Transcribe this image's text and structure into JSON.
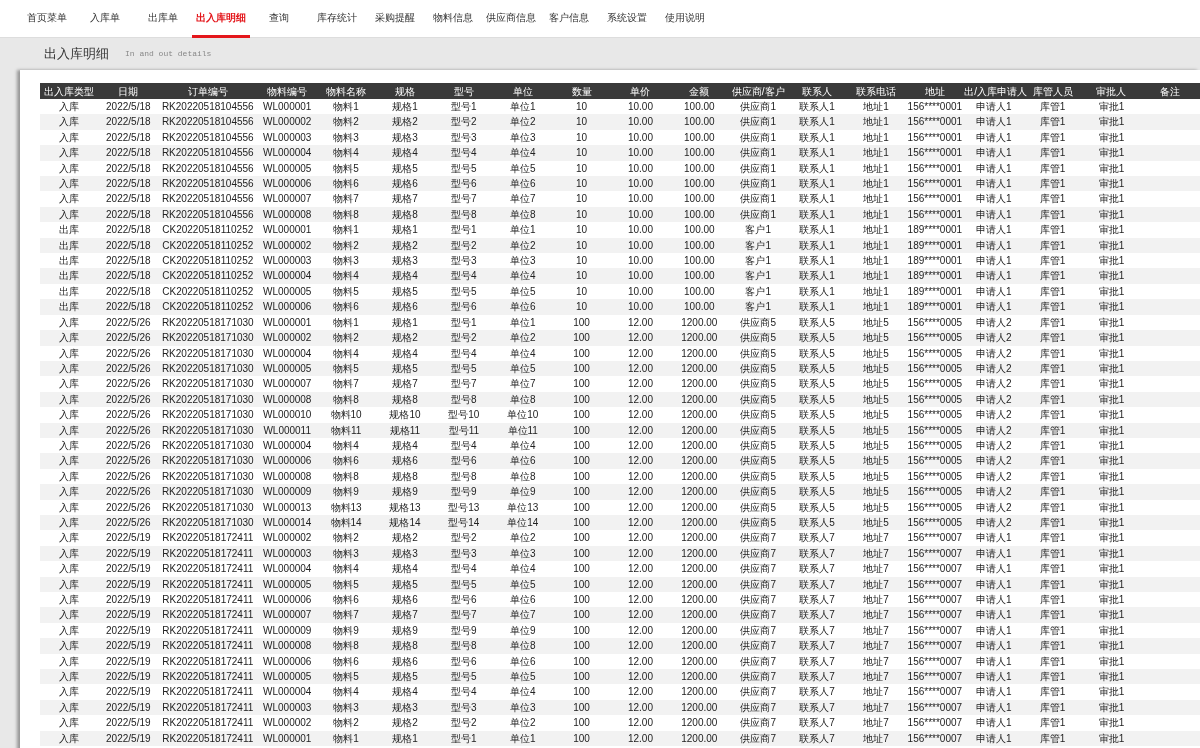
{
  "nav": [
    {
      "label": "首页菜单",
      "selected": false
    },
    {
      "label": "入库单",
      "selected": false
    },
    {
      "label": "出库单",
      "selected": false
    },
    {
      "label": "出入库明细",
      "selected": true
    },
    {
      "label": "查询",
      "selected": false
    },
    {
      "label": "库存统计",
      "selected": false
    },
    {
      "label": "采购提醒",
      "selected": false
    },
    {
      "label": "物料信息",
      "selected": false
    },
    {
      "label": "供应商信息",
      "selected": false
    },
    {
      "label": "客户信息",
      "selected": false
    },
    {
      "label": "系统设置",
      "selected": false
    },
    {
      "label": "使用说明",
      "selected": false
    }
  ],
  "page": {
    "title": "出入库明细",
    "subtitle": "In and out details"
  },
  "table": {
    "columns": [
      "出入库类型",
      "日期",
      "订单编号",
      "物料编号",
      "物料名称",
      "规格",
      "型号",
      "单位",
      "数量",
      "单价",
      "金额",
      "供应商/客户",
      "联系人",
      "联系电话",
      "地址",
      "出/入库申请人",
      "库管人员",
      "审批人",
      "备注"
    ],
    "rows": [
      {
        "cells": [
          "入库",
          "2022/5/18",
          "RK20220518104556",
          "WL000001",
          "物料1",
          "规格1",
          "型号1",
          "单位1",
          "10",
          "10.00",
          "100.00",
          "供应商1",
          "联系人1",
          "地址1",
          "156****0001",
          "申请人1",
          "库管1",
          "审批1"
        ]
      },
      {
        "cells": [
          "入库",
          "2022/5/18",
          "RK20220518104556",
          "WL000002",
          "物料2",
          "规格2",
          "型号2",
          "单位2",
          "10",
          "10.00",
          "100.00",
          "供应商1",
          "联系人1",
          "地址1",
          "156****0001",
          "申请人1",
          "库管1",
          "审批1"
        ]
      },
      {
        "cells": [
          "入库",
          "2022/5/18",
          "RK20220518104556",
          "WL000003",
          "物料3",
          "规格3",
          "型号3",
          "单位3",
          "10",
          "10.00",
          "100.00",
          "供应商1",
          "联系人1",
          "地址1",
          "156****0001",
          "申请人1",
          "库管1",
          "审批1"
        ]
      },
      {
        "cells": [
          "入库",
          "2022/5/18",
          "RK20220518104556",
          "WL000004",
          "物料4",
          "规格4",
          "型号4",
          "单位4",
          "10",
          "10.00",
          "100.00",
          "供应商1",
          "联系人1",
          "地址1",
          "156****0001",
          "申请人1",
          "库管1",
          "审批1"
        ]
      },
      {
        "cells": [
          "入库",
          "2022/5/18",
          "RK20220518104556",
          "WL000005",
          "物料5",
          "规格5",
          "型号5",
          "单位5",
          "10",
          "10.00",
          "100.00",
          "供应商1",
          "联系人1",
          "地址1",
          "156****0001",
          "申请人1",
          "库管1",
          "审批1"
        ]
      },
      {
        "cells": [
          "入库",
          "2022/5/18",
          "RK20220518104556",
          "WL000006",
          "物料6",
          "规格6",
          "型号6",
          "单位6",
          "10",
          "10.00",
          "100.00",
          "供应商1",
          "联系人1",
          "地址1",
          "156****0001",
          "申请人1",
          "库管1",
          "审批1"
        ]
      },
      {
        "cells": [
          "入库",
          "2022/5/18",
          "RK20220518104556",
          "WL000007",
          "物料7",
          "规格7",
          "型号7",
          "单位7",
          "10",
          "10.00",
          "100.00",
          "供应商1",
          "联系人1",
          "地址1",
          "156****0001",
          "申请人1",
          "库管1",
          "审批1"
        ]
      },
      {
        "cells": [
          "入库",
          "2022/5/18",
          "RK20220518104556",
          "WL000008",
          "物料8",
          "规格8",
          "型号8",
          "单位8",
          "10",
          "10.00",
          "100.00",
          "供应商1",
          "联系人1",
          "地址1",
          "156****0001",
          "申请人1",
          "库管1",
          "审批1"
        ]
      },
      {
        "cells": [
          "出库",
          "2022/5/18",
          "CK20220518110252",
          "WL000001",
          "物料1",
          "规格1",
          "型号1",
          "单位1",
          "10",
          "10.00",
          "100.00",
          "客户1",
          "联系人1",
          "地址1",
          "189****0001",
          "申请人1",
          "库管1",
          "审批1"
        ]
      },
      {
        "cells": [
          "出库",
          "2022/5/18",
          "CK20220518110252",
          "WL000002",
          "物料2",
          "规格2",
          "型号2",
          "单位2",
          "10",
          "10.00",
          "100.00",
          "客户1",
          "联系人1",
          "地址1",
          "189****0001",
          "申请人1",
          "库管1",
          "审批1"
        ]
      },
      {
        "cells": [
          "出库",
          "2022/5/18",
          "CK20220518110252",
          "WL000003",
          "物料3",
          "规格3",
          "型号3",
          "单位3",
          "10",
          "10.00",
          "100.00",
          "客户1",
          "联系人1",
          "地址1",
          "189****0001",
          "申请人1",
          "库管1",
          "审批1"
        ]
      },
      {
        "cells": [
          "出库",
          "2022/5/18",
          "CK20220518110252",
          "WL000004",
          "物料4",
          "规格4",
          "型号4",
          "单位4",
          "10",
          "10.00",
          "100.00",
          "客户1",
          "联系人1",
          "地址1",
          "189****0001",
          "申请人1",
          "库管1",
          "审批1"
        ]
      },
      {
        "cells": [
          "出库",
          "2022/5/18",
          "CK20220518110252",
          "WL000005",
          "物料5",
          "规格5",
          "型号5",
          "单位5",
          "10",
          "10.00",
          "100.00",
          "客户1",
          "联系人1",
          "地址1",
          "189****0001",
          "申请人1",
          "库管1",
          "审批1"
        ]
      },
      {
        "cells": [
          "出库",
          "2022/5/18",
          "CK20220518110252",
          "WL000006",
          "物料6",
          "规格6",
          "型号6",
          "单位6",
          "10",
          "10.00",
          "100.00",
          "客户1",
          "联系人1",
          "地址1",
          "189****0001",
          "申请人1",
          "库管1",
          "审批1"
        ]
      },
      {
        "cells": [
          "入库",
          "2022/5/26",
          "RK20220518171030",
          "WL000001",
          "物料1",
          "规格1",
          "型号1",
          "单位1",
          "100",
          "12.00",
          "1200.00",
          "供应商5",
          "联系人5",
          "地址5",
          "156****0005",
          "申请人2",
          "库管1",
          "审批1"
        ]
      },
      {
        "cells": [
          "入库",
          "2022/5/26",
          "RK20220518171030",
          "WL000002",
          "物料2",
          "规格2",
          "型号2",
          "单位2",
          "100",
          "12.00",
          "1200.00",
          "供应商5",
          "联系人5",
          "地址5",
          "156****0005",
          "申请人2",
          "库管1",
          "审批1"
        ]
      },
      {
        "cells": [
          "入库",
          "2022/5/26",
          "RK20220518171030",
          "WL000004",
          "物料4",
          "规格4",
          "型号4",
          "单位4",
          "100",
          "12.00",
          "1200.00",
          "供应商5",
          "联系人5",
          "地址5",
          "156****0005",
          "申请人2",
          "库管1",
          "审批1"
        ]
      },
      {
        "cells": [
          "入库",
          "2022/5/26",
          "RK20220518171030",
          "WL000005",
          "物料5",
          "规格5",
          "型号5",
          "单位5",
          "100",
          "12.00",
          "1200.00",
          "供应商5",
          "联系人5",
          "地址5",
          "156****0005",
          "申请人2",
          "库管1",
          "审批1"
        ]
      },
      {
        "cells": [
          "入库",
          "2022/5/26",
          "RK20220518171030",
          "WL000007",
          "物料7",
          "规格7",
          "型号7",
          "单位7",
          "100",
          "12.00",
          "1200.00",
          "供应商5",
          "联系人5",
          "地址5",
          "156****0005",
          "申请人2",
          "库管1",
          "审批1"
        ]
      },
      {
        "cells": [
          "入库",
          "2022/5/26",
          "RK20220518171030",
          "WL000008",
          "物料8",
          "规格8",
          "型号8",
          "单位8",
          "100",
          "12.00",
          "1200.00",
          "供应商5",
          "联系人5",
          "地址5",
          "156****0005",
          "申请人2",
          "库管1",
          "审批1"
        ]
      },
      {
        "cells": [
          "入库",
          "2022/5/26",
          "RK20220518171030",
          "WL000010",
          "物料10",
          "规格10",
          "型号10",
          "单位10",
          "100",
          "12.00",
          "1200.00",
          "供应商5",
          "联系人5",
          "地址5",
          "156****0005",
          "申请人2",
          "库管1",
          "审批1"
        ]
      },
      {
        "cells": [
          "入库",
          "2022/5/26",
          "RK20220518171030",
          "WL000011",
          "物料11",
          "规格11",
          "型号11",
          "单位11",
          "100",
          "12.00",
          "1200.00",
          "供应商5",
          "联系人5",
          "地址5",
          "156****0005",
          "申请人2",
          "库管1",
          "审批1"
        ]
      },
      {
        "cells": [
          "入库",
          "2022/5/26",
          "RK20220518171030",
          "WL000004",
          "物料4",
          "规格4",
          "型号4",
          "单位4",
          "100",
          "12.00",
          "1200.00",
          "供应商5",
          "联系人5",
          "地址5",
          "156****0005",
          "申请人2",
          "库管1",
          "审批1"
        ]
      },
      {
        "cells": [
          "入库",
          "2022/5/26",
          "RK20220518171030",
          "WL000006",
          "物料6",
          "规格6",
          "型号6",
          "单位6",
          "100",
          "12.00",
          "1200.00",
          "供应商5",
          "联系人5",
          "地址5",
          "156****0005",
          "申请人2",
          "库管1",
          "审批1"
        ]
      },
      {
        "cells": [
          "入库",
          "2022/5/26",
          "RK20220518171030",
          "WL000008",
          "物料8",
          "规格8",
          "型号8",
          "单位8",
          "100",
          "12.00",
          "1200.00",
          "供应商5",
          "联系人5",
          "地址5",
          "156****0005",
          "申请人2",
          "库管1",
          "审批1"
        ]
      },
      {
        "cells": [
          "入库",
          "2022/5/26",
          "RK20220518171030",
          "WL000009",
          "物料9",
          "规格9",
          "型号9",
          "单位9",
          "100",
          "12.00",
          "1200.00",
          "供应商5",
          "联系人5",
          "地址5",
          "156****0005",
          "申请人2",
          "库管1",
          "审批1"
        ]
      },
      {
        "cells": [
          "入库",
          "2022/5/26",
          "RK20220518171030",
          "WL000013",
          "物料13",
          "规格13",
          "型号13",
          "单位13",
          "100",
          "12.00",
          "1200.00",
          "供应商5",
          "联系人5",
          "地址5",
          "156****0005",
          "申请人2",
          "库管1",
          "审批1"
        ]
      },
      {
        "cells": [
          "入库",
          "2022/5/26",
          "RK20220518171030",
          "WL000014",
          "物料14",
          "规格14",
          "型号14",
          "单位14",
          "100",
          "12.00",
          "1200.00",
          "供应商5",
          "联系人5",
          "地址5",
          "156****0005",
          "申请人2",
          "库管1",
          "审批1"
        ]
      },
      {
        "cells": [
          "入库",
          "2022/5/19",
          "RK20220518172411",
          "WL000002",
          "物料2",
          "规格2",
          "型号2",
          "单位2",
          "100",
          "12.00",
          "1200.00",
          "供应商7",
          "联系人7",
          "地址7",
          "156****0007",
          "申请人1",
          "库管1",
          "审批1"
        ]
      },
      {
        "cells": [
          "入库",
          "2022/5/19",
          "RK20220518172411",
          "WL000003",
          "物料3",
          "规格3",
          "型号3",
          "单位3",
          "100",
          "12.00",
          "1200.00",
          "供应商7",
          "联系人7",
          "地址7",
          "156****0007",
          "申请人1",
          "库管1",
          "审批1"
        ]
      },
      {
        "cells": [
          "入库",
          "2022/5/19",
          "RK20220518172411",
          "WL000004",
          "物料4",
          "规格4",
          "型号4",
          "单位4",
          "100",
          "12.00",
          "1200.00",
          "供应商7",
          "联系人7",
          "地址7",
          "156****0007",
          "申请人1",
          "库管1",
          "审批1"
        ]
      },
      {
        "cells": [
          "入库",
          "2022/5/19",
          "RK20220518172411",
          "WL000005",
          "物料5",
          "规格5",
          "型号5",
          "单位5",
          "100",
          "12.00",
          "1200.00",
          "供应商7",
          "联系人7",
          "地址7",
          "156****0007",
          "申请人1",
          "库管1",
          "审批1"
        ]
      },
      {
        "cells": [
          "入库",
          "2022/5/19",
          "RK20220518172411",
          "WL000006",
          "物料6",
          "规格6",
          "型号6",
          "单位6",
          "100",
          "12.00",
          "1200.00",
          "供应商7",
          "联系人7",
          "地址7",
          "156****0007",
          "申请人1",
          "库管1",
          "审批1"
        ]
      },
      {
        "cells": [
          "入库",
          "2022/5/19",
          "RK20220518172411",
          "WL000007",
          "物料7",
          "规格7",
          "型号7",
          "单位7",
          "100",
          "12.00",
          "1200.00",
          "供应商7",
          "联系人7",
          "地址7",
          "156****0007",
          "申请人1",
          "库管1",
          "审批1"
        ]
      },
      {
        "cells": [
          "入库",
          "2022/5/19",
          "RK20220518172411",
          "WL000009",
          "物料9",
          "规格9",
          "型号9",
          "单位9",
          "100",
          "12.00",
          "1200.00",
          "供应商7",
          "联系人7",
          "地址7",
          "156****0007",
          "申请人1",
          "库管1",
          "审批1"
        ]
      },
      {
        "cells": [
          "入库",
          "2022/5/19",
          "RK20220518172411",
          "WL000008",
          "物料8",
          "规格8",
          "型号8",
          "单位8",
          "100",
          "12.00",
          "1200.00",
          "供应商7",
          "联系人7",
          "地址7",
          "156****0007",
          "申请人1",
          "库管1",
          "审批1"
        ]
      },
      {
        "cells": [
          "入库",
          "2022/5/19",
          "RK20220518172411",
          "WL000006",
          "物料6",
          "规格6",
          "型号6",
          "单位6",
          "100",
          "12.00",
          "1200.00",
          "供应商7",
          "联系人7",
          "地址7",
          "156****0007",
          "申请人1",
          "库管1",
          "审批1"
        ]
      },
      {
        "cells": [
          "入库",
          "2022/5/19",
          "RK20220518172411",
          "WL000005",
          "物料5",
          "规格5",
          "型号5",
          "单位5",
          "100",
          "12.00",
          "1200.00",
          "供应商7",
          "联系人7",
          "地址7",
          "156****0007",
          "申请人1",
          "库管1",
          "审批1"
        ]
      },
      {
        "cells": [
          "入库",
          "2022/5/19",
          "RK20220518172411",
          "WL000004",
          "物料4",
          "规格4",
          "型号4",
          "单位4",
          "100",
          "12.00",
          "1200.00",
          "供应商7",
          "联系人7",
          "地址7",
          "156****0007",
          "申请人1",
          "库管1",
          "审批1"
        ]
      },
      {
        "cells": [
          "入库",
          "2022/5/19",
          "RK20220518172411",
          "WL000003",
          "物料3",
          "规格3",
          "型号3",
          "单位3",
          "100",
          "12.00",
          "1200.00",
          "供应商7",
          "联系人7",
          "地址7",
          "156****0007",
          "申请人1",
          "库管1",
          "审批1"
        ]
      },
      {
        "cells": [
          "入库",
          "2022/5/19",
          "RK20220518172411",
          "WL000002",
          "物料2",
          "规格2",
          "型号2",
          "单位2",
          "100",
          "12.00",
          "1200.00",
          "供应商7",
          "联系人7",
          "地址7",
          "156****0007",
          "申请人1",
          "库管1",
          "审批1"
        ]
      },
      {
        "cells": [
          "入库",
          "2022/5/19",
          "RK20220518172411",
          "WL000001",
          "物料1",
          "规格1",
          "型号1",
          "单位1",
          "100",
          "12.00",
          "1200.00",
          "供应商7",
          "联系人7",
          "地址7",
          "156****0007",
          "申请人1",
          "库管1",
          "审批1"
        ]
      }
    ]
  }
}
